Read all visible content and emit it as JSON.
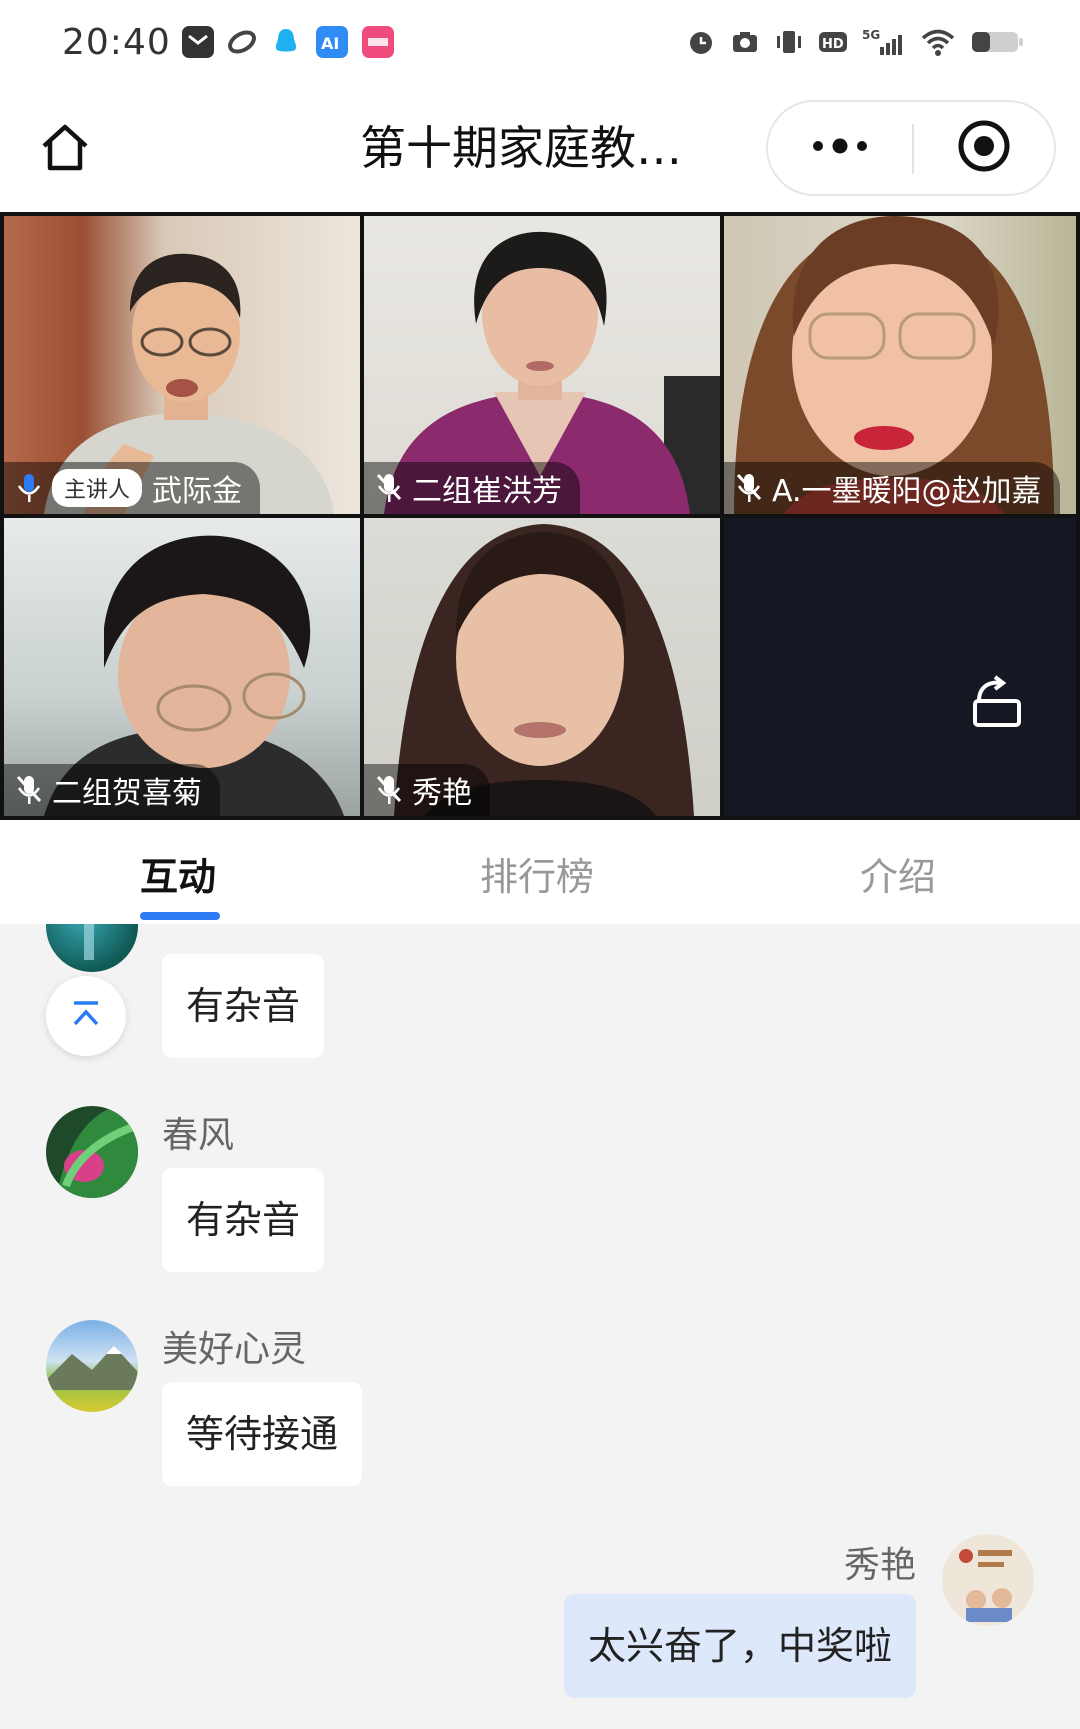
{
  "status_bar": {
    "time": "20:40",
    "left_icons": [
      "mail-app-icon",
      "link-app-icon",
      "qq-icon",
      "ai-app-icon",
      "lele-app-icon"
    ],
    "right_icons": [
      "alarm-icon",
      "camera-icon",
      "vibrate-icon",
      "hd-icon",
      "signal-5g-icon",
      "wifi-icon",
      "battery-icon"
    ],
    "network": "5G",
    "hd": "HD"
  },
  "header": {
    "title": "第十期家庭教…",
    "more_icon": "more-dots-icon",
    "close_icon": "record-target-icon"
  },
  "video_tiles": [
    {
      "name": "武际金",
      "host_badge": "主讲人",
      "mic": "mic-on"
    },
    {
      "name": "二组崔洪芳",
      "mic": "mic-muted"
    },
    {
      "name": "A.一墨暖阳@赵加嘉",
      "mic": "mic-muted"
    },
    {
      "name": "二组贺喜菊",
      "mic": "mic-muted"
    },
    {
      "name": "秀艳",
      "mic": "mic-muted"
    }
  ],
  "rotate_icon": "rotate-screen-icon",
  "tabs": [
    {
      "label": "互动",
      "active": true
    },
    {
      "label": "排行榜",
      "active": false
    },
    {
      "label": "介绍",
      "active": false
    }
  ],
  "chat": {
    "messages": [
      {
        "sender": "",
        "text": "有杂音",
        "mine": false
      },
      {
        "sender": "春风",
        "text": "有杂音",
        "mine": false
      },
      {
        "sender": "美好心灵",
        "text": "等待接通",
        "mine": false
      },
      {
        "sender": "秀艳",
        "text": "太兴奋了，中奖啦",
        "mine": true
      }
    ],
    "scroll_top_icon": "scroll-to-top-icon"
  },
  "colors": {
    "accent": "#2d7bf4",
    "chat_bg": "#f3f3f3",
    "bubble_bg": "#ffffff",
    "my_bubble_bg": "#dde8fb"
  }
}
